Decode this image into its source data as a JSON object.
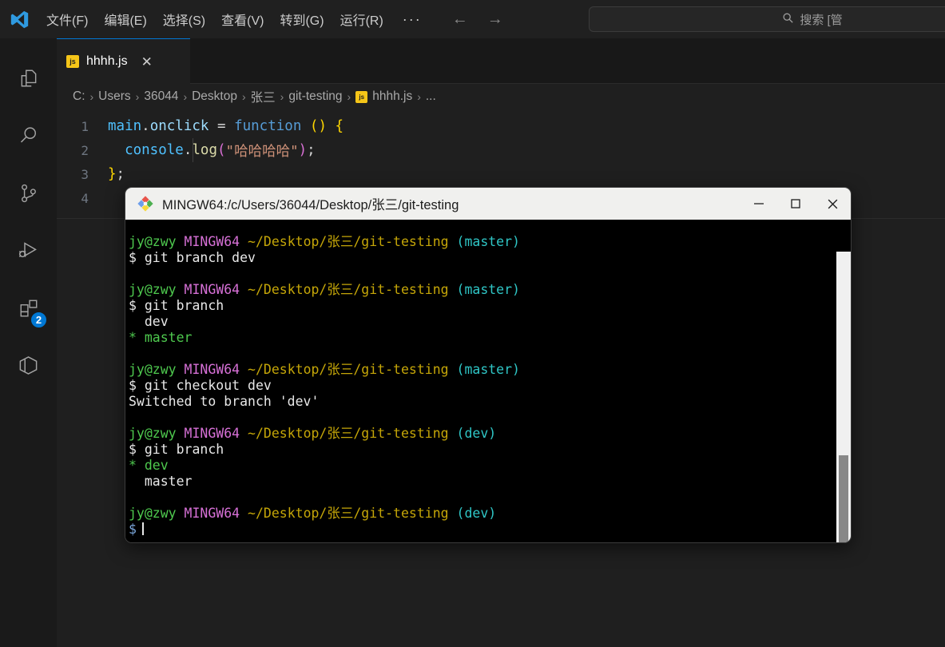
{
  "app": {
    "logo_icon": "vscode-logo",
    "menu": [
      {
        "label": "文件(F)"
      },
      {
        "label": "编辑(E)"
      },
      {
        "label": "选择(S)"
      },
      {
        "label": "查看(V)"
      },
      {
        "label": "转到(G)"
      },
      {
        "label": "运行(R)"
      }
    ],
    "menu_more": "···",
    "nav": {
      "back": "←",
      "forward": "→"
    },
    "search": {
      "icon": "search-icon",
      "placeholder": "搜索 [管",
      "value": ""
    }
  },
  "activitybar": {
    "items": [
      {
        "name": "explorer",
        "icon": "files-icon"
      },
      {
        "name": "search",
        "icon": "search-icon"
      },
      {
        "name": "source-control",
        "icon": "source-control-icon"
      },
      {
        "name": "run-debug",
        "icon": "run-debug-icon"
      },
      {
        "name": "extensions",
        "icon": "extensions-icon",
        "badge": "2",
        "badge_color": "#0078d4"
      },
      {
        "name": "remote-explorer",
        "icon": "remote-icon"
      }
    ]
  },
  "editor": {
    "tab": {
      "file_icon": "js",
      "label": "hhhh.js",
      "close": "✕"
    },
    "breadcrumb": {
      "separator": "›",
      "segments": [
        "C:",
        "Users",
        "36044",
        "Desktop",
        "张三",
        "git-testing"
      ],
      "file_icon": "js",
      "file": "hhhh.js",
      "ellipsis": "..."
    },
    "lines": [
      {
        "number": "1"
      },
      {
        "number": "2"
      },
      {
        "number": "3"
      },
      {
        "number": "4"
      }
    ],
    "code": {
      "l1_obj": "main",
      "l1_dot": ".",
      "l1_prop": "onclick",
      "l1_eq": " = ",
      "l1_kw": "function",
      "l1_paren": " ()",
      "l1_brace": " {",
      "l2_obj": "console",
      "l2_dot": ".",
      "l2_fn": "log",
      "l2_paren_open": "(",
      "l2_str": "\"哈哈哈哈\"",
      "l2_paren_close": ")",
      "l2_semi": ";",
      "l3_brace": "}",
      "l3_semi": ";"
    }
  },
  "terminal": {
    "icon": "git-bash-icon",
    "title": "MINGW64:/c/Users/36044/Desktop/张三/git-testing",
    "window_controls": {
      "minimize": "—",
      "maximize": "☐",
      "close": "✕"
    },
    "prompts": {
      "user": "jy@zwy",
      "host": "MINGW64",
      "path": "~/Desktop/张三/git-testing",
      "branch_master": "(master)",
      "branch_dev": "(dev)",
      "sigil": "$"
    },
    "lines": [
      {
        "type": "prompt",
        "branch": "(master)"
      },
      {
        "type": "cmd",
        "text": "$ git branch dev"
      },
      {
        "type": "blank"
      },
      {
        "type": "prompt",
        "branch": "(master)"
      },
      {
        "type": "cmd",
        "text": "$ git branch"
      },
      {
        "type": "out",
        "text": "  dev"
      },
      {
        "type": "out-green",
        "star": "*",
        "text": " master"
      },
      {
        "type": "blank"
      },
      {
        "type": "prompt",
        "branch": "(master)"
      },
      {
        "type": "cmd",
        "text": "$ git checkout dev"
      },
      {
        "type": "out",
        "text": "Switched to branch 'dev'"
      },
      {
        "type": "blank"
      },
      {
        "type": "prompt",
        "branch": "(dev)"
      },
      {
        "type": "cmd",
        "text": "$ git branch"
      },
      {
        "type": "out-green",
        "star": "*",
        "text": " dev"
      },
      {
        "type": "out",
        "text": "  master"
      },
      {
        "type": "blank"
      },
      {
        "type": "prompt",
        "branch": "(dev)"
      },
      {
        "type": "cmd-cursor",
        "text": "$"
      }
    ],
    "text": {
      "cmd_git_branch_dev": "$ git branch dev",
      "cmd_git_branch": "$ git branch",
      "cmd_git_checkout_dev": "$ git checkout dev",
      "out_switched": "Switched to branch 'dev'",
      "out_dev_indent": "  dev",
      "out_master_indent": "  master",
      "star": "*",
      "star_dev": " dev",
      "star_master": " master",
      "prompt_last": "$"
    }
  },
  "colors": {
    "accent": "#0078d4",
    "js_yellow": "#f5c518",
    "term_green": "#4ec94e",
    "term_magenta": "#d670d6",
    "term_yellow": "#c5a608",
    "term_cyan": "#2fc6c6"
  }
}
